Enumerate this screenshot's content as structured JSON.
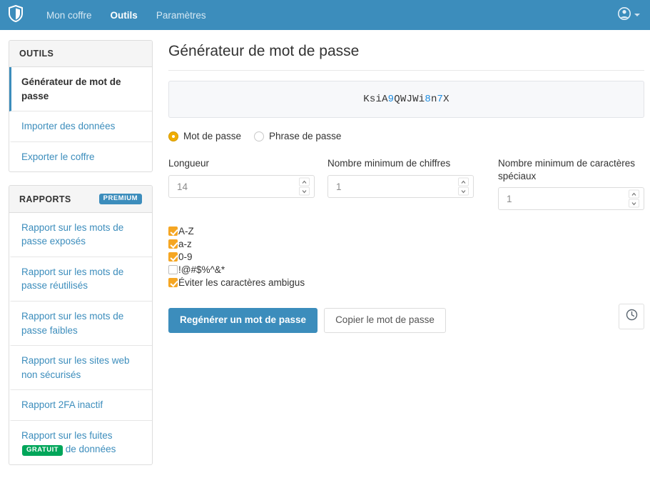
{
  "header": {
    "logo_icon": "shield-icon",
    "nav": [
      {
        "label": "Mon coffre",
        "active": false
      },
      {
        "label": "Outils",
        "active": true
      },
      {
        "label": "Paramètres",
        "active": false
      }
    ],
    "account_icon": "user-circle-icon",
    "account_caret_icon": "chevron-down-icon"
  },
  "sidebar": {
    "tools": {
      "title": "OUTILS",
      "items": [
        {
          "label": "Générateur de mot de passe",
          "active": true
        },
        {
          "label": "Importer des données",
          "active": false
        },
        {
          "label": "Exporter le coffre",
          "active": false
        }
      ]
    },
    "reports": {
      "title": "RAPPORTS",
      "badge": "PREMIUM",
      "badge_color": "#3c8dbc",
      "items": [
        {
          "label": "Rapport sur les mots de passe exposés",
          "badge": ""
        },
        {
          "label": "Rapport sur les mots de passe réutilisés",
          "badge": ""
        },
        {
          "label": "Rapport sur les mots de passe faibles",
          "badge": ""
        },
        {
          "label": "Rapport sur les sites web non sécurisés",
          "badge": ""
        },
        {
          "label": "Rapport 2FA inactif",
          "badge": ""
        }
      ],
      "last_item": {
        "label_part1": "Rapport sur les fuites",
        "badge": "GRATUIT",
        "badge_color": "#00a65a",
        "label_part2": " de données"
      }
    }
  },
  "main": {
    "title": "Générateur de mot de passe",
    "password": {
      "value": "KsiA9QWJWi8n7X",
      "digit_color": "#1d8ce0",
      "chars": [
        {
          "c": "K",
          "digit": false
        },
        {
          "c": "s",
          "digit": false
        },
        {
          "c": "i",
          "digit": false
        },
        {
          "c": "A",
          "digit": false
        },
        {
          "c": "9",
          "digit": true
        },
        {
          "c": "Q",
          "digit": false
        },
        {
          "c": "W",
          "digit": false
        },
        {
          "c": "J",
          "digit": false
        },
        {
          "c": "W",
          "digit": false
        },
        {
          "c": "i",
          "digit": false
        },
        {
          "c": "8",
          "digit": true
        },
        {
          "c": "n",
          "digit": false
        },
        {
          "c": "7",
          "digit": true
        },
        {
          "c": "X",
          "digit": false
        }
      ]
    },
    "type_options": [
      {
        "label": "Mot de passe",
        "selected": true
      },
      {
        "label": "Phrase de passe",
        "selected": false
      }
    ],
    "radio_accent": "#f0ad00",
    "fields": [
      {
        "label": "Longueur",
        "value": "14"
      },
      {
        "label": "Nombre minimum de chiffres",
        "value": "1"
      },
      {
        "label": "Nombre minimum de caractères spéciaux",
        "value": "1"
      }
    ],
    "checkboxes": [
      {
        "label": "A-Z",
        "checked": true
      },
      {
        "label": "a-z",
        "checked": true
      },
      {
        "label": "0-9",
        "checked": true
      },
      {
        "label": "!@#$%^&*",
        "checked": false
      },
      {
        "label": "Éviter les caractères ambigus",
        "checked": true
      }
    ],
    "checkbox_accent": "#f5a623",
    "buttons": {
      "regenerate": "Regénérer un mot de passe",
      "copy": "Copier le mot de passe",
      "history_icon": "clock-history-icon"
    }
  }
}
